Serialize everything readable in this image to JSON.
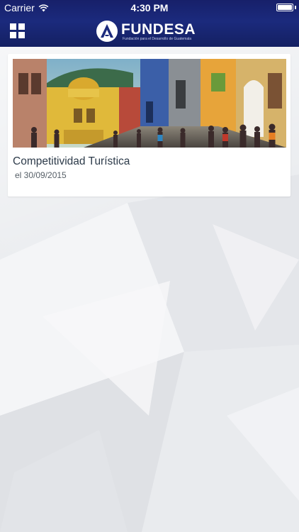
{
  "status_bar": {
    "carrier": "Carrier",
    "time": "4:30 PM",
    "battery_level": 1.0,
    "wifi_icon": "wifi-icon"
  },
  "nav": {
    "menu_icon": "grid-menu-icon",
    "logo": {
      "name": "FUNDESA",
      "tagline": "Fundación para el Desarrollo de Guatemala"
    }
  },
  "colors": {
    "header": "#1b2a7d",
    "card_title": "#2d3b4a",
    "background": "#ebedf0"
  },
  "articles": [
    {
      "title": "Competitividad Turística",
      "date": "el 30/09/2015",
      "image": "colonial-street-photo"
    }
  ]
}
